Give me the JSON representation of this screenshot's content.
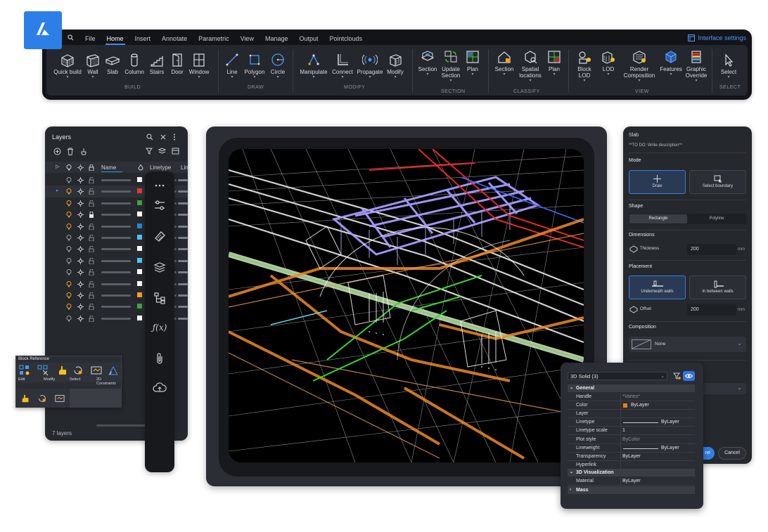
{
  "ribbon": {
    "menu": [
      "File",
      "Home",
      "Insert",
      "Annotate",
      "Parametric",
      "View",
      "Manage",
      "Output",
      "Pointclouds"
    ],
    "active_menu": "Home",
    "interface_settings": "Interface settings",
    "tools": {
      "quick_build": "Quick build",
      "wall": "Wall",
      "slab": "Slab",
      "column": "Column",
      "stairs": "Stairs",
      "door": "Door",
      "window": "Window",
      "line": "Line",
      "polygon": "Polygon",
      "circle": "Circle",
      "manipulate": "Manipulate",
      "connect": "Connect",
      "propagate": "Propagate",
      "modify": "Modify",
      "section1": "Section",
      "update_section_1": "Update",
      "update_section_2": "Section",
      "plan1": "Plan",
      "section2": "Section",
      "spatial_locations_1": "Spatial",
      "spatial_locations_2": "locations",
      "plan2": "Plan",
      "block_lod_1": "Block",
      "block_lod_2": "LOD",
      "lod": "LOD",
      "render_composition_1": "Render",
      "render_composition_2": "Composition",
      "features": "Features",
      "graphic_override_1": "Graphic",
      "graphic_override_2": "Override",
      "select": "Select"
    },
    "groups": {
      "build": "BUILD",
      "draw": "DRAW",
      "modify": "MODIFY",
      "section": "SECTION",
      "classify": "CLASSIFY",
      "view": "VIEW",
      "select": "SELECT"
    }
  },
  "layers": {
    "title": "Layers",
    "columns": {
      "name": "Name",
      "linetype": "Linetype",
      "lin": "Lin"
    },
    "footer": "7 layers",
    "rows": [
      {
        "color": "#ffffff",
        "bulb": "#9aa0a8",
        "lock": "open"
      },
      {
        "color": "#e53935",
        "bulb": "#f0a020",
        "lock": "open"
      },
      {
        "color": "#43a047",
        "bulb": "#f0a020",
        "lock": "open"
      },
      {
        "color": "#ffffff",
        "bulb": "#f0a020",
        "lock": "closed"
      },
      {
        "color": "#1e88e5",
        "bulb": "#f0a020",
        "lock": "open"
      },
      {
        "color": "#4fc3f7",
        "bulb": "#9aa0a8",
        "lock": "open"
      },
      {
        "color": "#ffffff",
        "bulb": "#9aa0a8",
        "lock": "open"
      },
      {
        "color": "#4fc3f7",
        "bulb": "#9aa0a8",
        "lock": "open"
      },
      {
        "color": "#ffffff",
        "bulb": "#9aa0a8",
        "lock": "open"
      },
      {
        "color": "#ffffff",
        "bulb": "#f0a020",
        "lock": "open"
      },
      {
        "color": "#f0a020",
        "bulb": "#f0a020",
        "lock": "open"
      },
      {
        "color": "#43a047",
        "bulb": "#f0a020",
        "lock": "open"
      },
      {
        "color": "#ffffff",
        "bulb": "#9aa0a8",
        "lock": "open"
      }
    ]
  },
  "block_reference": {
    "title": "Block Reference",
    "labels": {
      "edit": "Edit",
      "modify": "Modify",
      "select": "Select",
      "constraints_1": "2D",
      "constraints_2": "Constraints"
    }
  },
  "slab_panel": {
    "title": "Slab",
    "description": "**TO DO: Write description**",
    "mode_label": "Mode",
    "mode_draw": "Draw",
    "mode_select_boundary": "Select boundary",
    "shape_label": "Shape",
    "shape_rectangle": "Rectangle",
    "shape_polyline": "Polyline",
    "dimensions_label": "Dimensions",
    "thickness_label": "Thickness",
    "thickness_value": "200",
    "thickness_unit": "mm",
    "placement_label": "Placement",
    "placement_underneath": "Underneath walls",
    "placement_between": "In between walls",
    "offset_label": "Offset",
    "offset_value": "200",
    "offset_unit": "mm",
    "composition_label": "Composition",
    "composition_value": "None",
    "ok_label": "ne",
    "cancel_label": "Cancel"
  },
  "properties": {
    "selection": "3D Solid (3)",
    "general_label": "General",
    "rows": [
      {
        "key": "Handle",
        "value": "*Varies*"
      },
      {
        "key": "Color",
        "value": "ByLayer"
      },
      {
        "key": "Layer",
        "value": ""
      },
      {
        "key": "Linetype",
        "value": "ByLayer"
      },
      {
        "key": "Linetype scale",
        "value": "1"
      },
      {
        "key": "Plot style",
        "value": "ByColor"
      },
      {
        "key": "Lineweight",
        "value": "ByLayer"
      },
      {
        "key": "Transparency",
        "value": "ByLayer"
      },
      {
        "key": "Hyperlink",
        "value": ""
      }
    ],
    "viz_label": "3D Visualization",
    "material_key": "Material",
    "material_value": "ByLayer",
    "mass_label": "Mass",
    "color_swatch": "#f07d1a"
  },
  "colors": {
    "accent": "#2f7fe6",
    "orange": "#f08a24",
    "purple": "#a79cff",
    "green": "#38d430",
    "red": "#e8262a",
    "cyan": "#5fd3e8"
  }
}
